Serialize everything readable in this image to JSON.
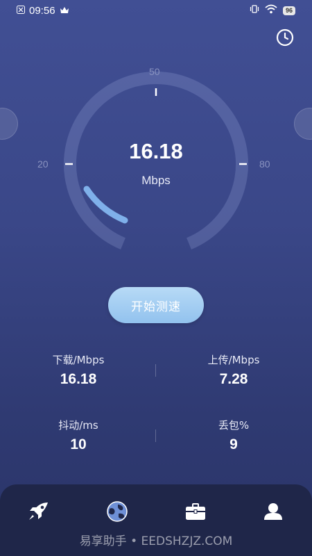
{
  "status_bar": {
    "time": "09:56",
    "battery": "96"
  },
  "gauge": {
    "scale_top": "50",
    "scale_left": "20",
    "scale_right": "80",
    "speed": "16.18",
    "unit": "Mbps"
  },
  "start_button_label": "开始测速",
  "stats": {
    "download": {
      "label": "下载/Mbps",
      "value": "16.18"
    },
    "upload": {
      "label": "上传/Mbps",
      "value": "7.28"
    },
    "jitter": {
      "label": "抖动/ms",
      "value": "10"
    },
    "packet_loss": {
      "label": "丢包%",
      "value": "9"
    }
  },
  "bottom_nav": {
    "items": [
      {
        "icon": "rocket-icon"
      },
      {
        "icon": "globe-icon"
      },
      {
        "icon": "briefcase-icon"
      },
      {
        "icon": "user-icon"
      }
    ]
  },
  "watermark": "易享助手 • EEDSHZJZ.COM"
}
